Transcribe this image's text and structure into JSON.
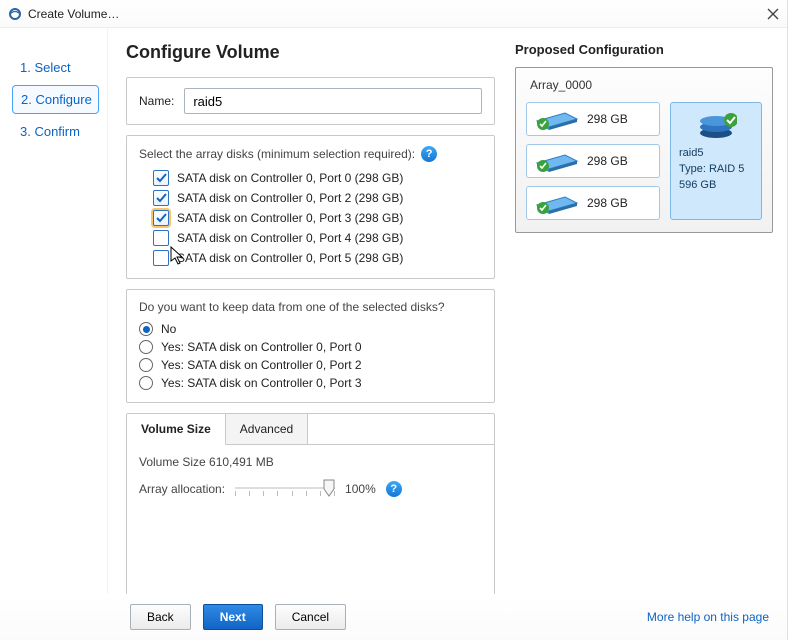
{
  "window": {
    "title": "Create Volume…"
  },
  "sidebar": {
    "steps": [
      {
        "label": "1. Select"
      },
      {
        "label": "2. Configure"
      },
      {
        "label": "3. Confirm"
      }
    ]
  },
  "page": {
    "heading": "Configure Volume",
    "name_label": "Name:",
    "name_value": "raid5",
    "select_disks_label": "Select the array disks (minimum selection required):",
    "disks": [
      {
        "label": "SATA disk on Controller 0, Port 0 (298 GB)",
        "checked": true,
        "hilite": false
      },
      {
        "label": "SATA disk on Controller 0, Port 2 (298 GB)",
        "checked": true,
        "hilite": false
      },
      {
        "label": "SATA disk on Controller 0, Port 3 (298 GB)",
        "checked": true,
        "hilite": true
      },
      {
        "label": "SATA disk on Controller 0, Port 4 (298 GB)",
        "checked": false,
        "hilite": false
      },
      {
        "label": "SATA disk on Controller 0, Port 5 (298 GB)",
        "checked": false,
        "hilite": false
      }
    ],
    "keep_label": "Do you want to keep data from one of the selected disks?",
    "keep_options": [
      {
        "label": "No",
        "selected": true
      },
      {
        "label": "Yes: SATA disk on Controller 0, Port 0",
        "selected": false
      },
      {
        "label": "Yes: SATA disk on Controller 0, Port 2",
        "selected": false
      },
      {
        "label": "Yes: SATA disk on Controller 0, Port 3",
        "selected": false
      }
    ],
    "tabs": [
      {
        "label": "Volume Size"
      },
      {
        "label": "Advanced"
      }
    ],
    "volsize_line": "Volume Size 610,491 MB",
    "alloc_label": "Array allocation:",
    "alloc_value": "100%"
  },
  "proposed": {
    "heading": "Proposed Configuration",
    "array_name": "Array_0000",
    "disks": [
      {
        "size": "298 GB"
      },
      {
        "size": "298 GB"
      },
      {
        "size": "298 GB"
      }
    ],
    "raid": {
      "name": "raid5",
      "type": "Type: RAID 5",
      "size": "596 GB"
    }
  },
  "footer": {
    "back": "Back",
    "next": "Next",
    "cancel": "Cancel",
    "help_link": "More help on this page"
  }
}
